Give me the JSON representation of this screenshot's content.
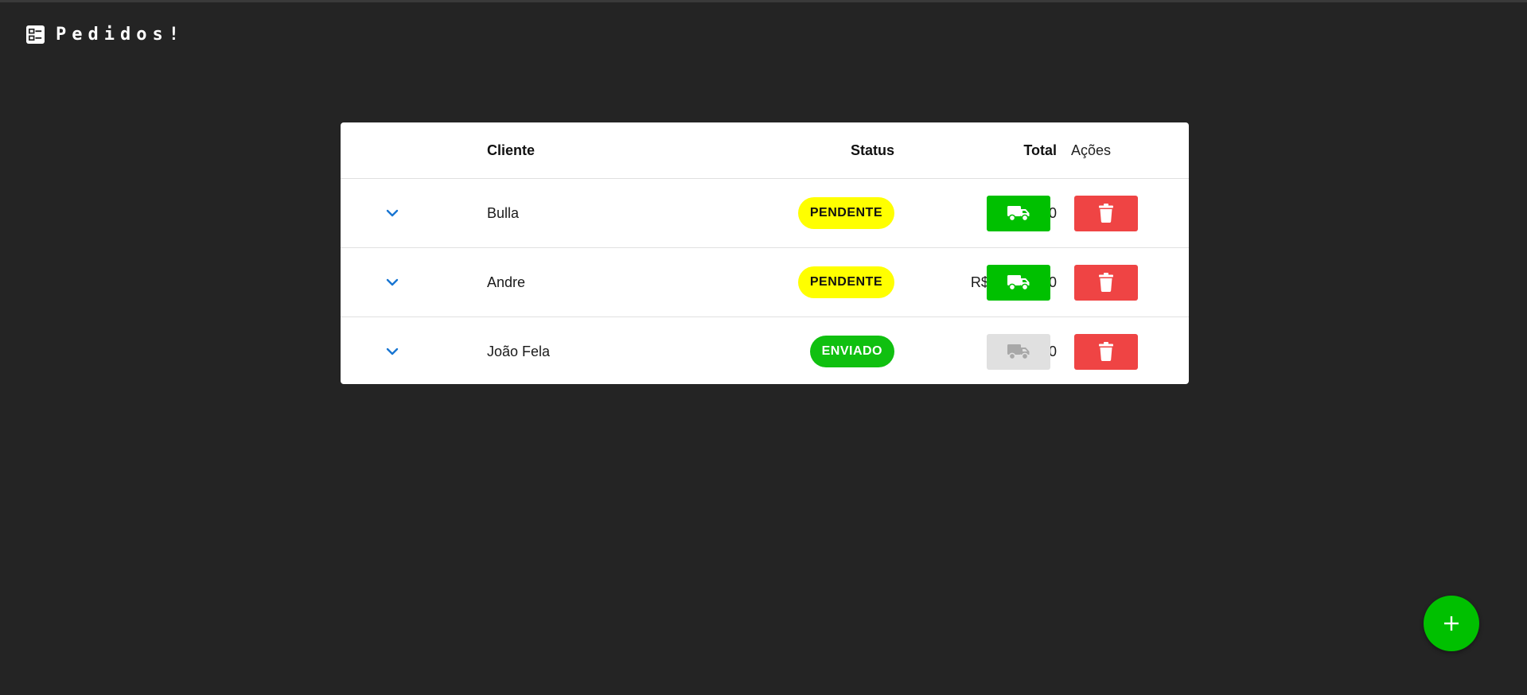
{
  "app": {
    "title": "Pedidos!",
    "icon": "list-check-icon"
  },
  "table": {
    "headers": {
      "cliente": "Cliente",
      "status": "Status",
      "total": "Total",
      "acoes": "Ações"
    },
    "rows": [
      {
        "cliente": "Bulla",
        "status": "PENDENTE",
        "status_color": "#ffff00",
        "total": "R$ 520,00",
        "ship_enabled": true
      },
      {
        "cliente": "Andre",
        "status": "PENDENTE",
        "status_color": "#ffff00",
        "total": "R$ 31.587,00",
        "ship_enabled": true
      },
      {
        "cliente": "João Fela",
        "status": "ENVIADO",
        "status_color": "#10c010",
        "total": "R$ 50,00",
        "ship_enabled": false
      }
    ]
  },
  "icons": {
    "expand": "chevron-down-icon",
    "ship": "truck-icon",
    "delete": "trash-icon",
    "add": "plus-icon"
  },
  "colors": {
    "background": "#242424",
    "ship_button": "#00c000",
    "ship_button_disabled": "#e0e0e0",
    "delete_button": "#ef4444",
    "pending": "#ffff00",
    "sent": "#10c010",
    "chevron": "#1976d2"
  }
}
